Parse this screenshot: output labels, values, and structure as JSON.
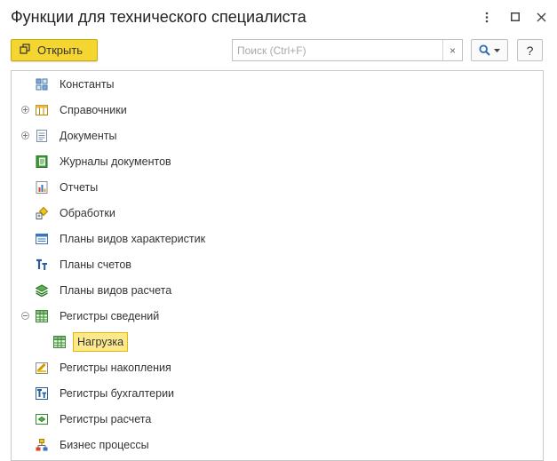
{
  "window": {
    "title": "Функции для технического специалиста",
    "more_icon": "more-vertical-icon",
    "maximize_icon": "maximize-icon",
    "close_icon": "close-icon"
  },
  "toolbar": {
    "open_label": "Открыть",
    "search_placeholder": "Поиск (Ctrl+F)",
    "search_value": "",
    "clear_label": "×",
    "help_label": "?"
  },
  "tree": {
    "items": [
      {
        "label": "Константы",
        "icon": "constants-icon",
        "toggle": ""
      },
      {
        "label": "Справочники",
        "icon": "catalogs-icon",
        "toggle": "expand"
      },
      {
        "label": "Документы",
        "icon": "documents-icon",
        "toggle": "expand"
      },
      {
        "label": "Журналы документов",
        "icon": "document-journals-icon",
        "toggle": ""
      },
      {
        "label": "Отчеты",
        "icon": "reports-icon",
        "toggle": ""
      },
      {
        "label": "Обработки",
        "icon": "data-processors-icon",
        "toggle": ""
      },
      {
        "label": "Планы видов характеристик",
        "icon": "characteristic-types-icon",
        "toggle": ""
      },
      {
        "label": "Планы счетов",
        "icon": "chart-of-accounts-icon",
        "toggle": ""
      },
      {
        "label": "Планы видов расчета",
        "icon": "calculation-types-icon",
        "toggle": ""
      },
      {
        "label": "Регистры сведений",
        "icon": "information-registers-icon",
        "toggle": "collapse"
      },
      {
        "label": "Нагрузка",
        "icon": "register-table-icon",
        "toggle": "",
        "child": true,
        "selected": true
      },
      {
        "label": "Регистры накопления",
        "icon": "accumulation-registers-icon",
        "toggle": ""
      },
      {
        "label": "Регистры бухгалтерии",
        "icon": "accounting-registers-icon",
        "toggle": ""
      },
      {
        "label": "Регистры расчета",
        "icon": "calculation-registers-icon",
        "toggle": ""
      },
      {
        "label": "Бизнес процессы",
        "icon": "business-processes-icon",
        "toggle": ""
      }
    ]
  },
  "colors": {
    "accent_yellow": "#f5d631",
    "selection_fill": "#fde98d",
    "selection_border": "#e6b800"
  }
}
